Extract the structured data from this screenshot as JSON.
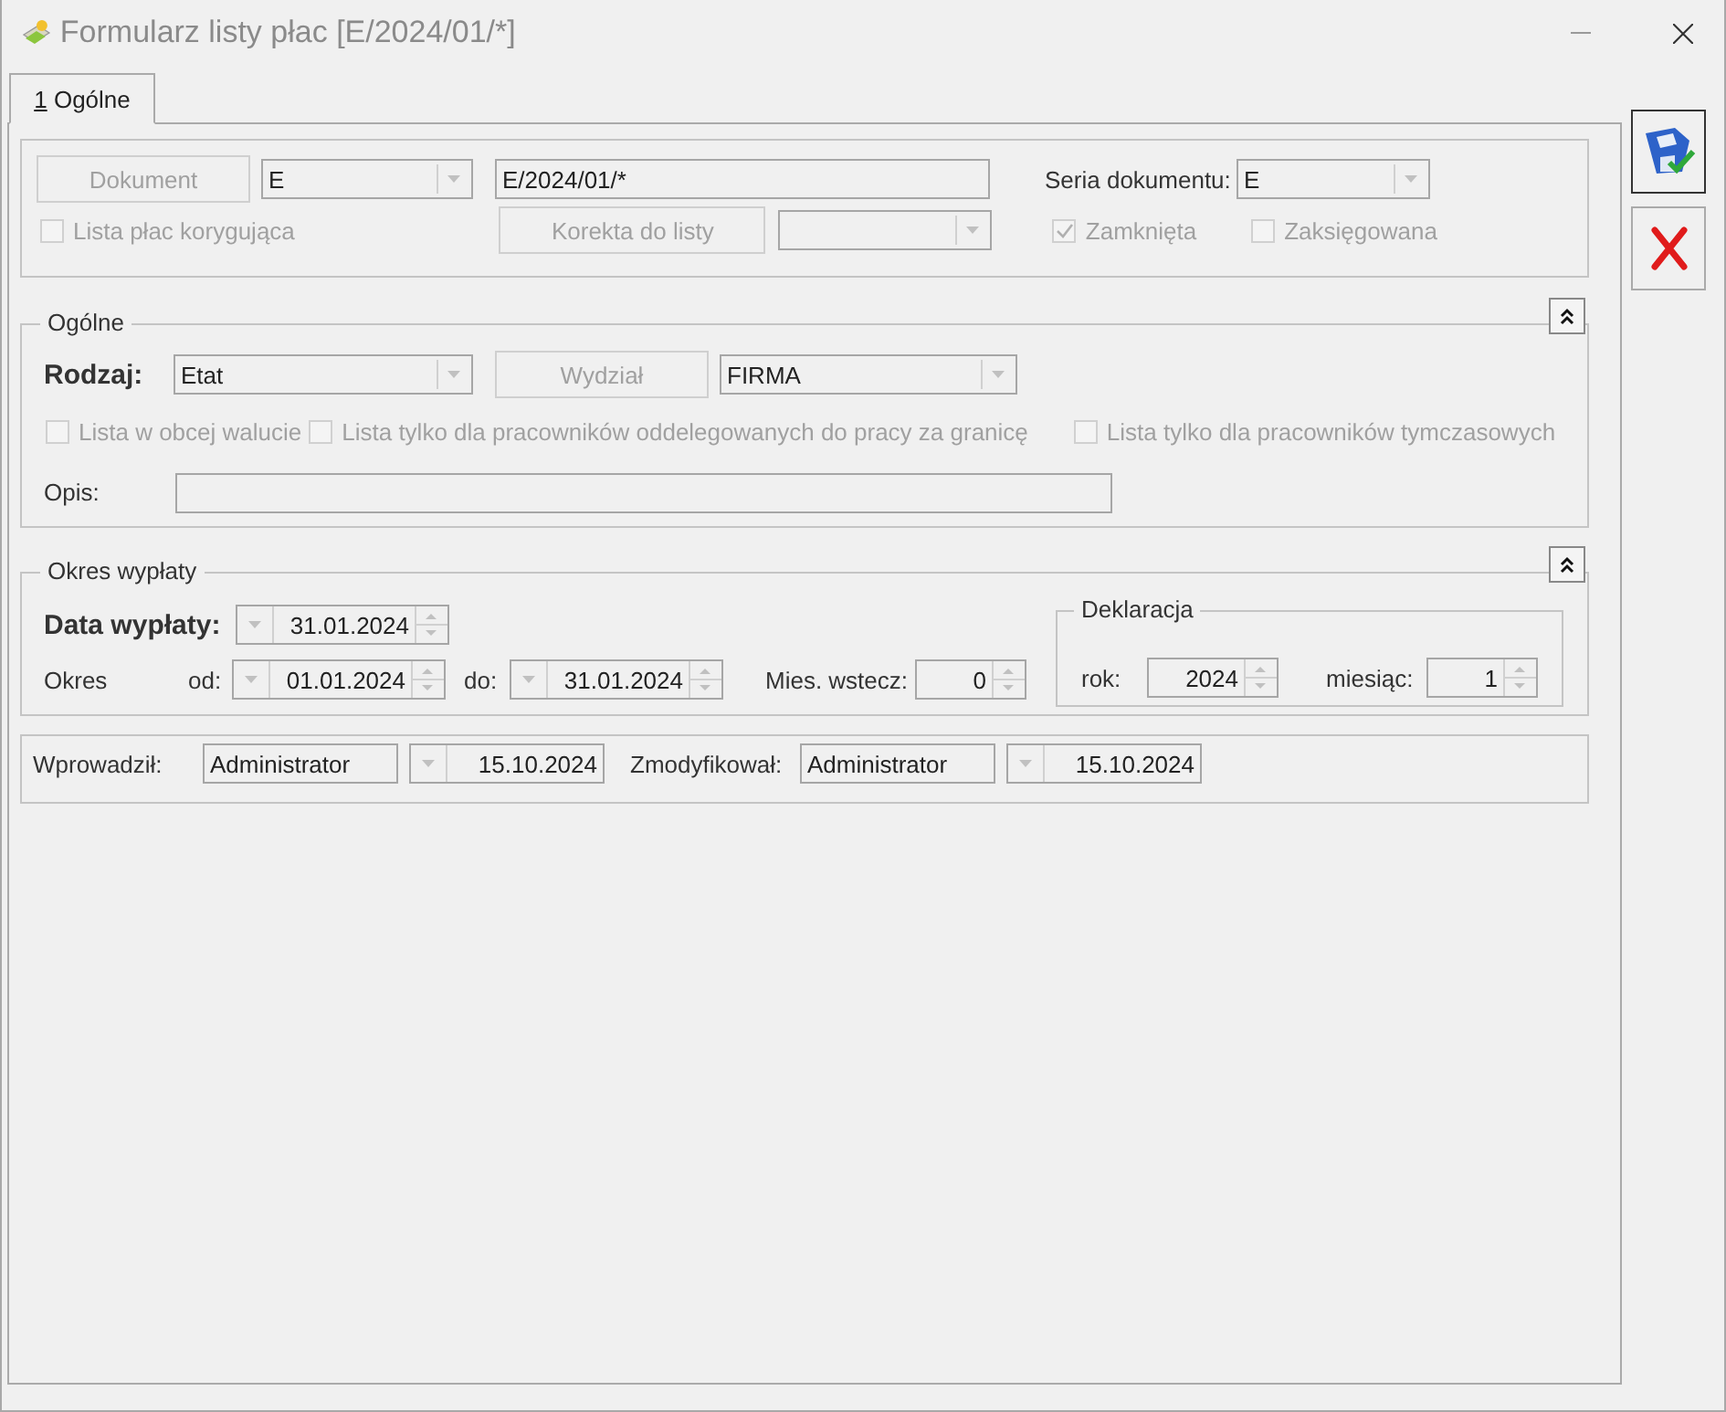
{
  "window": {
    "title": "Formularz listy płac [E/2024/01/*]"
  },
  "tabs": [
    {
      "label": "1 Ogólne",
      "selected": true
    }
  ],
  "document": {
    "document_button": {
      "label": "Dokument",
      "disabled": true
    },
    "series_combo": "E",
    "number": "E/2024/01/*",
    "corrective": {
      "label": "Lista płac korygująca",
      "checked": false,
      "disabled": true
    },
    "correction_button": {
      "label": "Korekta do listy",
      "disabled": true
    },
    "series_label": "Seria dokumentu:",
    "series": "E",
    "closed": {
      "label": "Zamknięta",
      "checked": true,
      "disabled": true
    },
    "posted": {
      "label": "Zaksięgowana",
      "checked": false,
      "disabled": true
    }
  },
  "general": {
    "title": "Ogólne",
    "type_label": "Rodzaj:",
    "type": "Etat",
    "department_button": {
      "label": "Wydział",
      "disabled": true
    },
    "department": "FIRMA",
    "options": [
      {
        "label": "Lista w obcej walucie",
        "checked": false,
        "disabled": true
      },
      {
        "label": "Lista tylko dla pracowników oddelegowanych do pracy za granicę",
        "checked": false,
        "disabled": true
      },
      {
        "label": "Lista tylko dla pracowników tymczasowych",
        "checked": false,
        "disabled": true
      }
    ],
    "description_label": "Opis:"
  },
  "payment": {
    "title": "Okres wypłaty",
    "date_label": "Data wypłaty:",
    "date": "31.01.2024",
    "period_label": "Okres",
    "from_label": "od:",
    "from": "01.01.2024",
    "to_label": "do:",
    "to": "31.01.2024",
    "months_back_label": "Mies. wstecz:",
    "months_back": "0",
    "declaration": {
      "title": "Deklaracja",
      "year_label": "rok:",
      "year": "2024",
      "month_label": "miesiąc:",
      "month": "1"
    }
  },
  "audit": {
    "created_label": "Wprowadził:",
    "created_by": "Administrator",
    "created_on": "15.10.2024",
    "modified_label": "Zmodyfikował:",
    "modified_by": "Administrator",
    "modified_on": "15.10.2024"
  }
}
